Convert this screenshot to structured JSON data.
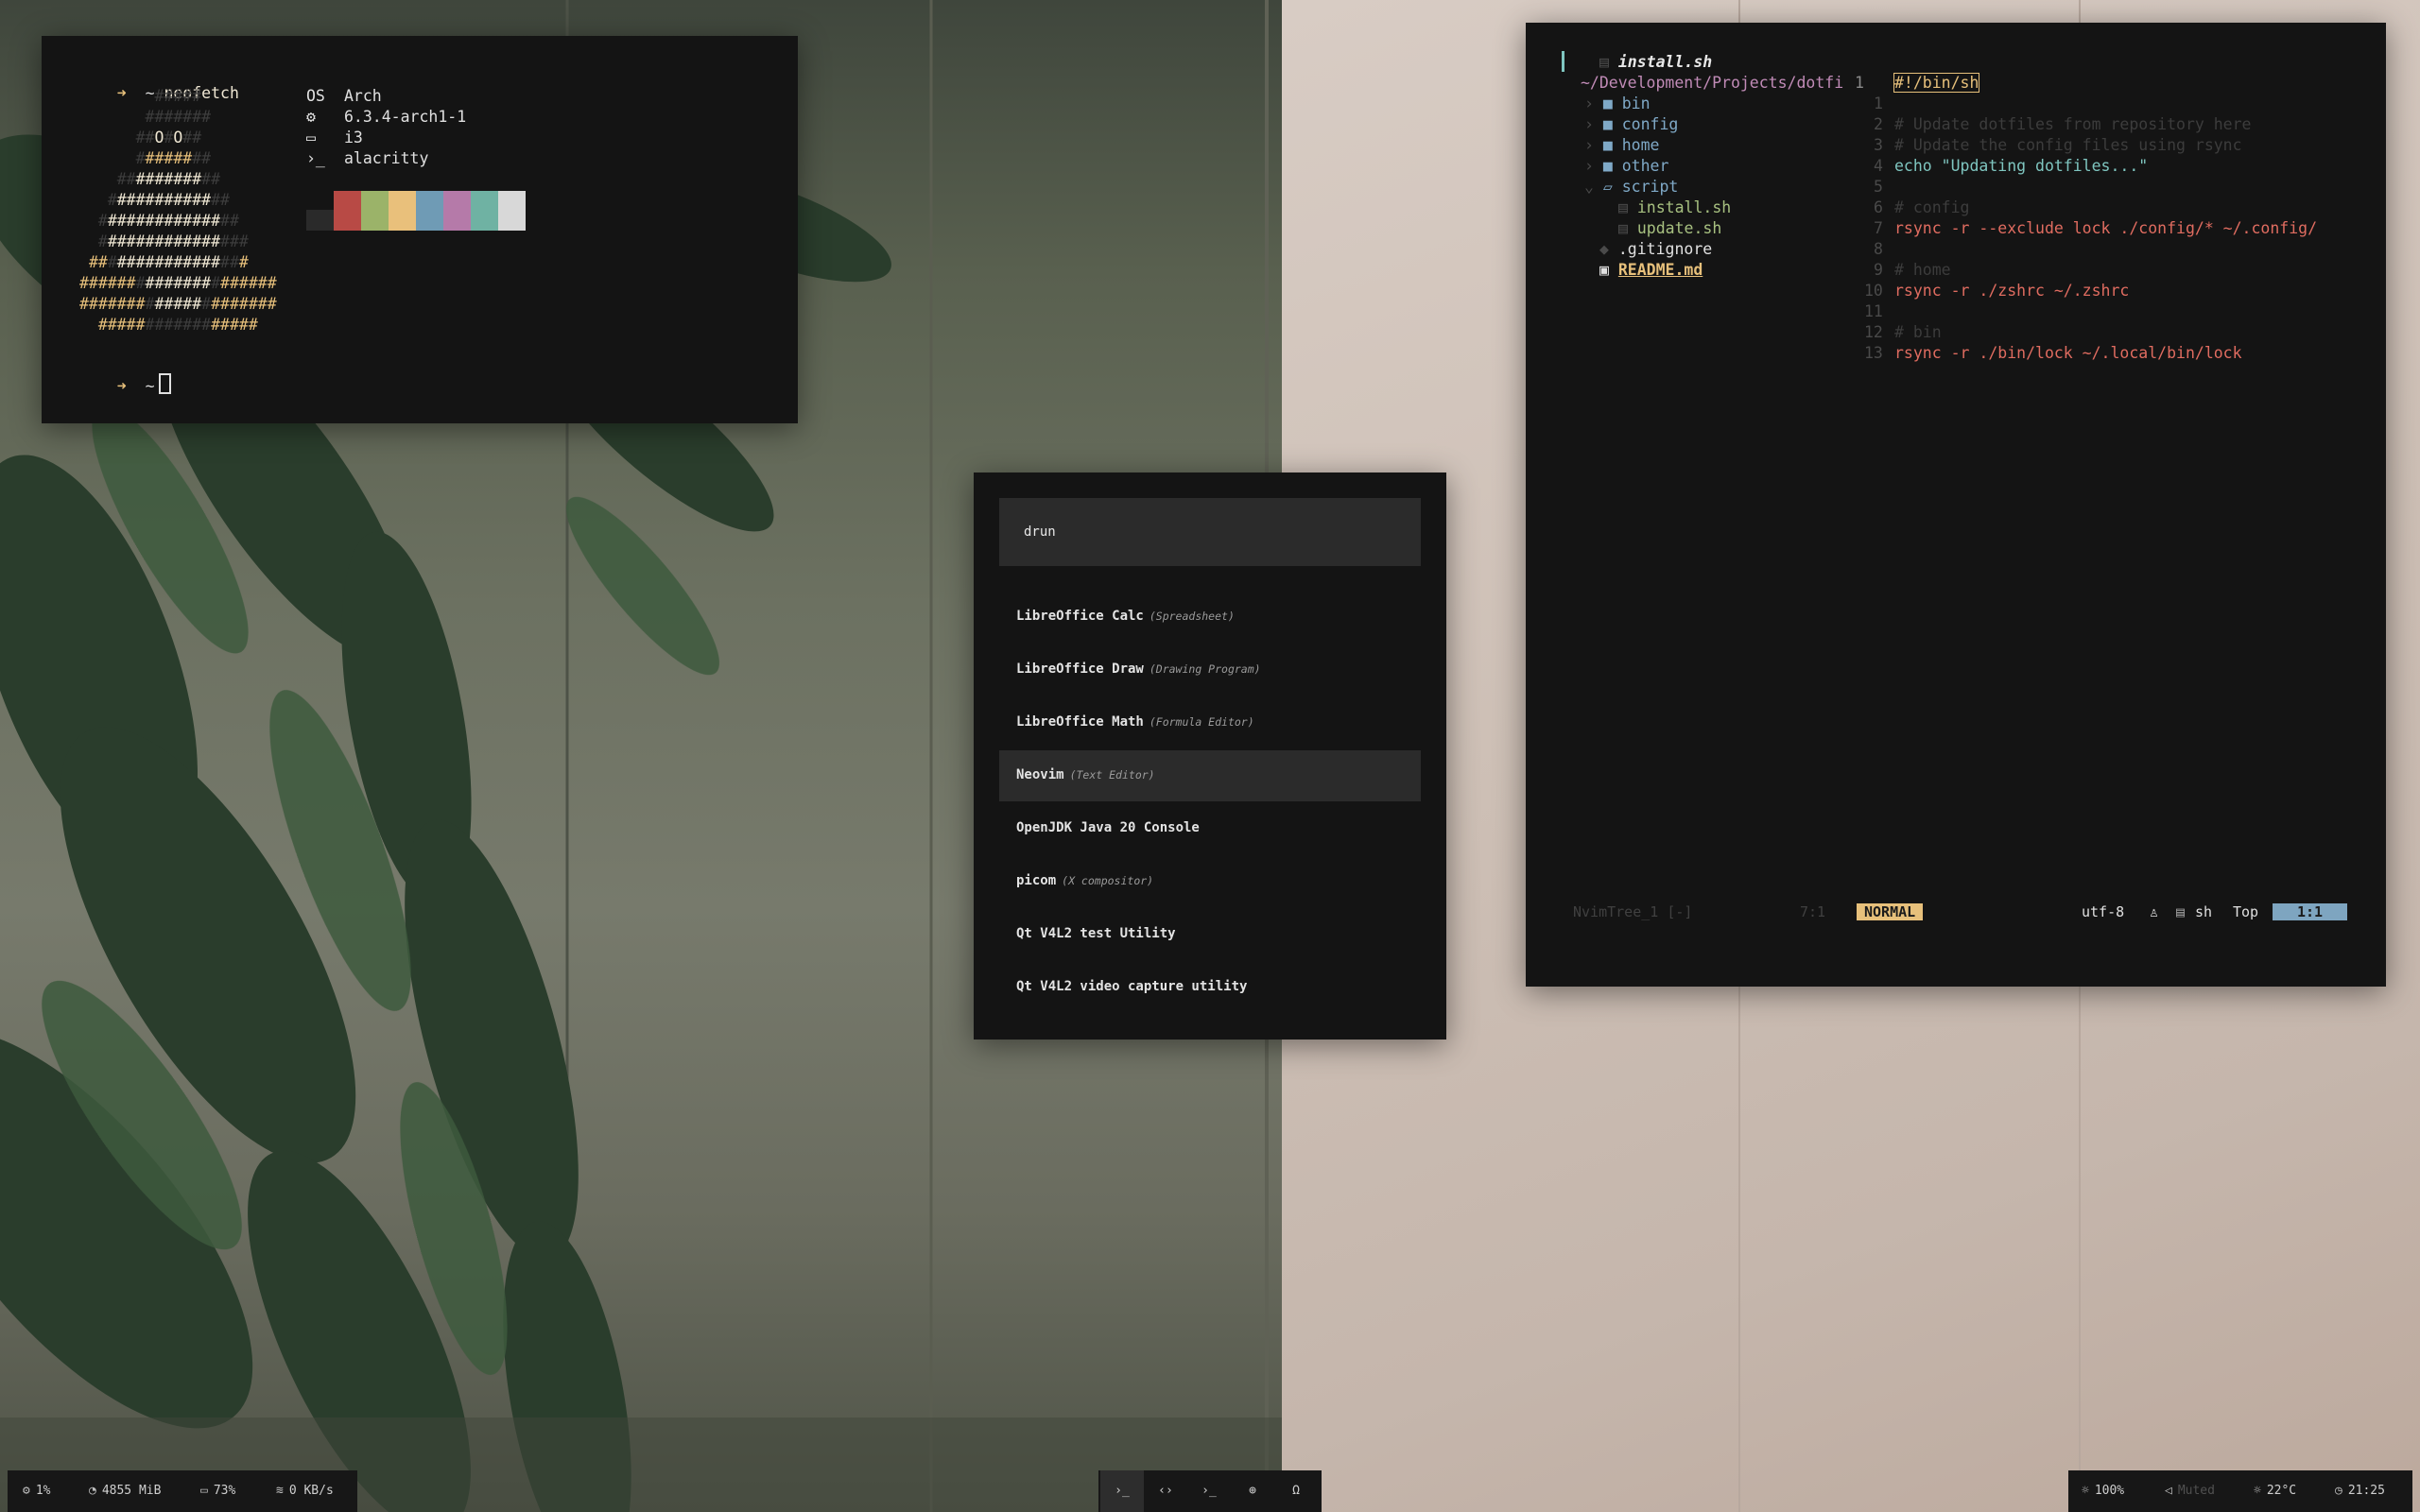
{
  "terminal": {
    "command": "neofetch",
    "prompt_arrow": "➜",
    "prompt_dir": "~",
    "info": [
      {
        "label": "OS",
        "value": "Arch",
        "icon": "os-label"
      },
      {
        "label": "⚙",
        "value": "6.3.4-arch1-1",
        "icon": "kernel-chip-icon"
      },
      {
        "label": "▭",
        "value": "i3",
        "icon": "monitor-icon"
      },
      {
        "label": "›_",
        "value": "alacritty",
        "icon": "terminal-prompt-icon"
      }
    ],
    "palette": [
      "#2a2a2a",
      "#b84a45",
      "#9bb369",
      "#e9c07b",
      "#6f9bb5",
      "#b57aa9",
      "#6fb2a3",
      "#d8d8d8"
    ]
  },
  "launcher": {
    "query": "drun",
    "entries": [
      {
        "name": "LibreOffice Calc",
        "desc": "(Spreadsheet)"
      },
      {
        "name": "LibreOffice Draw",
        "desc": "(Drawing Program)"
      },
      {
        "name": "LibreOffice Math",
        "desc": "(Formula Editor)"
      },
      {
        "name": "Neovim",
        "desc": "(Text Editor)",
        "selected": true
      },
      {
        "name": "OpenJDK Java 20 Console",
        "desc": ""
      },
      {
        "name": "picom",
        "desc": "(X compositor)"
      },
      {
        "name": "Qt V4L2 test Utility",
        "desc": ""
      },
      {
        "name": "Qt V4L2 video capture utility",
        "desc": ""
      }
    ]
  },
  "nvim": {
    "tree": {
      "header_file": "install.sh",
      "path": "~/Development/Projects/dotfi",
      "items": [
        {
          "name": "bin",
          "type": "dir"
        },
        {
          "name": "config",
          "type": "dir"
        },
        {
          "name": "home",
          "type": "dir"
        },
        {
          "name": "other",
          "type": "dir"
        },
        {
          "name": "script",
          "type": "dir-open"
        },
        {
          "name": "install.sh",
          "type": "file-green"
        },
        {
          "name": "update.sh",
          "type": "file-green"
        },
        {
          "name": ".gitignore",
          "type": "file"
        },
        {
          "name": "README.md",
          "type": "file-md"
        }
      ]
    },
    "code": [
      {
        "n": "1",
        "text": "#!/bin/sh"
      },
      {
        "n": "1",
        "text": ""
      },
      {
        "n": "2",
        "text": "# Update dotfiles from repository here"
      },
      {
        "n": "3",
        "text": "# Update the config files using rsync"
      },
      {
        "n": "4",
        "text": "echo \"Updating dotfiles...\""
      },
      {
        "n": "5",
        "text": ""
      },
      {
        "n": "6",
        "text": "# config"
      },
      {
        "n": "7",
        "text": "rsync -r --exclude lock ./config/* ~/.config/"
      },
      {
        "n": "8",
        "text": ""
      },
      {
        "n": "9",
        "text": "# home"
      },
      {
        "n": "10",
        "text": "rsync -r ./zshrc ~/.zshrc"
      },
      {
        "n": "11",
        "text": ""
      },
      {
        "n": "12",
        "text": "# bin"
      },
      {
        "n": "13",
        "text": "rsync -r ./bin/lock ~/.local/bin/lock"
      }
    ],
    "statusline": {
      "tree_name": "NvimTree_1 [-]",
      "tree_pos": "7:1",
      "mode": "NORMAL",
      "encoding": "utf-8",
      "os_icon": "linux-penguin-icon",
      "filetype": "sh",
      "scroll": "Top",
      "cursor": "1:1"
    }
  },
  "statusbar": {
    "left": [
      {
        "icon": "cpu-icon",
        "value": "1%"
      },
      {
        "icon": "memory-icon",
        "value": "4855 MiB"
      },
      {
        "icon": "battery-icon",
        "value": "73%"
      },
      {
        "icon": "wifi-icon",
        "value": "0 KB/s"
      }
    ],
    "workspaces": [
      {
        "icon": "terminal-icon",
        "glyph": "›_",
        "active": true
      },
      {
        "icon": "code-icon",
        "glyph": "‹›",
        "active": false
      },
      {
        "icon": "terminal-icon",
        "glyph": "›_",
        "active": false
      },
      {
        "icon": "globe-icon",
        "glyph": "⊕",
        "active": false
      },
      {
        "icon": "headphones-icon",
        "glyph": "Ω",
        "active": false
      }
    ],
    "right": [
      {
        "icon": "brightness-icon",
        "value": "100%"
      },
      {
        "icon": "volume-icon",
        "value": "Muted"
      },
      {
        "icon": "temperature-icon",
        "value": "22°C"
      },
      {
        "icon": "clock-icon",
        "value": "21:25"
      }
    ]
  }
}
